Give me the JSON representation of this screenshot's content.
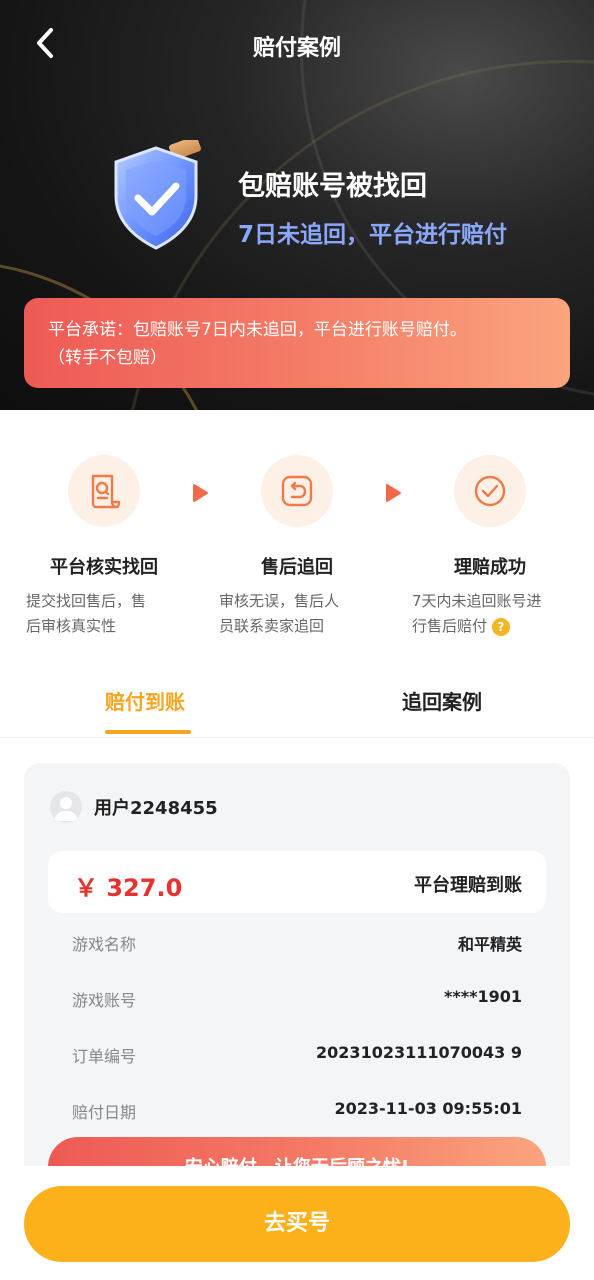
{
  "header": {
    "title": "赔付案例",
    "back_icon": "chevron-left-icon"
  },
  "hero": {
    "title": "包赔账号被找回",
    "subtitle": "7日未追回，平台进行赔付",
    "shield_icon": "shield-check-icon"
  },
  "promise": {
    "line1": "平台承诺：包赔账号7日内未追回，平台进行账号赔付。",
    "line2": "（转手不包赔）"
  },
  "steps": [
    {
      "icon": "document-search-icon",
      "title": "平台核实找回",
      "line1": "提交找回售后，售",
      "line2": "后审核真实性"
    },
    {
      "icon": "undo-icon",
      "title": "售后追回",
      "line1": "审核无误，售后人",
      "line2": "员联系卖家追回"
    },
    {
      "icon": "check-circle-icon",
      "title": "理赔成功",
      "line1": "7天内未追回账号进",
      "line2": "行售后赔付"
    }
  ],
  "help_glyph": "?",
  "tabs": [
    {
      "label": "赔付到账",
      "active": true
    },
    {
      "label": "追回案例",
      "active": false
    }
  ],
  "case_card": {
    "username": "用户2248455",
    "amount": "￥ 327.0",
    "amount_status": "平台理赔到账",
    "rows": [
      {
        "label": "游戏名称",
        "value": "和平精英"
      },
      {
        "label": "游戏账号",
        "value": "****1901"
      },
      {
        "label": "订单编号",
        "value": "20231023111070043 9"
      },
      {
        "label": "赔付日期",
        "value": "2023-11-03 09:55:01"
      }
    ],
    "slogan": "安心赔付，让您无后顾之忧!"
  },
  "buy_button": "去买号",
  "colors": {
    "accent_orange": "#f5a623",
    "button_yellow": "#fcb019",
    "price_red": "#e5322d",
    "gradient_start": "#ee5a55",
    "gradient_end": "#fba47e",
    "hero_sub_blue": "#8aa8ff"
  }
}
